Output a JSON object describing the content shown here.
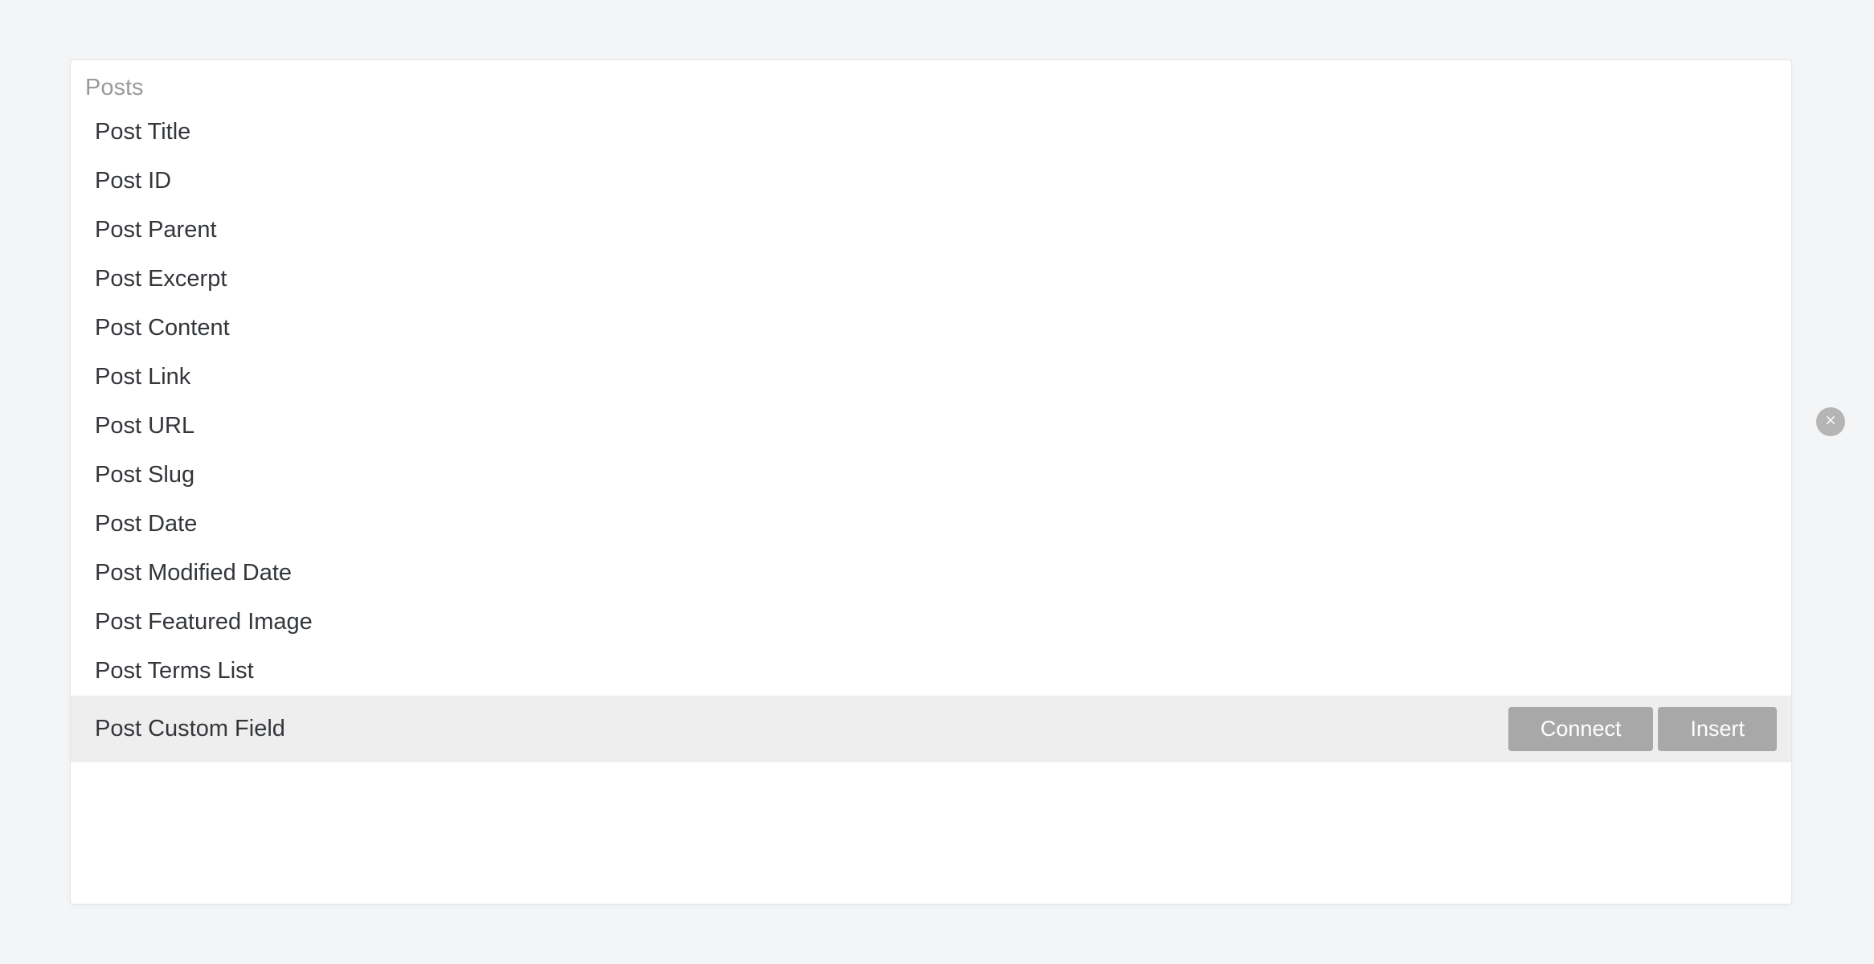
{
  "group": {
    "header": "Posts",
    "items": [
      {
        "label": "Post Title",
        "highlighted": false
      },
      {
        "label": "Post ID",
        "highlighted": false
      },
      {
        "label": "Post Parent",
        "highlighted": false
      },
      {
        "label": "Post Excerpt",
        "highlighted": false
      },
      {
        "label": "Post Content",
        "highlighted": false
      },
      {
        "label": "Post Link",
        "highlighted": false
      },
      {
        "label": "Post URL",
        "highlighted": false
      },
      {
        "label": "Post Slug",
        "highlighted": false
      },
      {
        "label": "Post Date",
        "highlighted": false
      },
      {
        "label": "Post Modified Date",
        "highlighted": false
      },
      {
        "label": "Post Featured Image",
        "highlighted": false
      },
      {
        "label": "Post Terms List",
        "highlighted": false
      },
      {
        "label": "Post Custom Field",
        "highlighted": true
      }
    ]
  },
  "actions": {
    "connect_label": "Connect",
    "insert_label": "Insert"
  }
}
